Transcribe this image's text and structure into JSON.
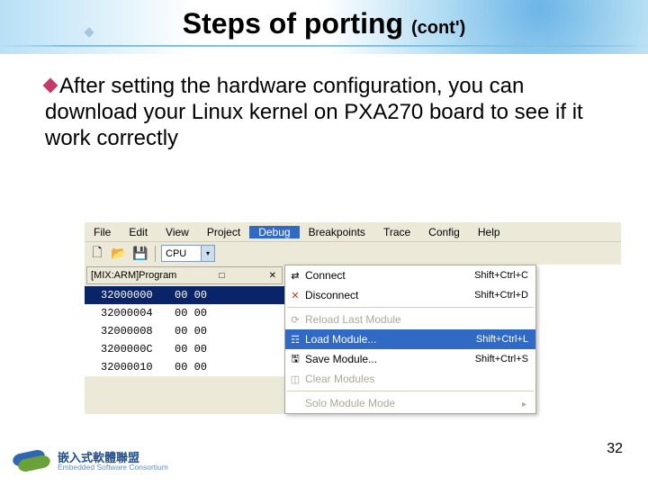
{
  "title": {
    "main": "Steps of porting ",
    "sub": "(cont')"
  },
  "body": "After setting the hardware configuration, you can download your Linux kernel on PXA270 board to see if it work correctly",
  "menubar": [
    "File",
    "Edit",
    "View",
    "Project",
    "Debug",
    "Breakpoints",
    "Trace",
    "Config",
    "Help"
  ],
  "menubar_selected": 4,
  "cpu_label": "CPU",
  "program_title": "[MIX:ARM]Program",
  "mem_rows": [
    {
      "addr": "32000000",
      "hex": "00  00"
    },
    {
      "addr": "32000004",
      "hex": "00  00"
    },
    {
      "addr": "32000008",
      "hex": "00  00"
    },
    {
      "addr": "3200000C",
      "hex": "00  00"
    },
    {
      "addr": "32000010",
      "hex": "00  00"
    }
  ],
  "menu": [
    {
      "icon": "⇄",
      "label": "Connect",
      "short": "Shift+Ctrl+C",
      "state": "en"
    },
    {
      "icon": "✕",
      "label": "Disconnect",
      "short": "Shift+Ctrl+D",
      "state": "en",
      "iconColor": "#c0392b"
    },
    {
      "sep": true
    },
    {
      "icon": "⟳",
      "label": "Reload Last Module",
      "short": "",
      "state": "dis"
    },
    {
      "icon": "☶",
      "label": "Load Module...",
      "short": "Shift+Ctrl+L",
      "state": "hl"
    },
    {
      "icon": "🖫",
      "label": "Save Module...",
      "short": "Shift+Ctrl+S",
      "state": "en"
    },
    {
      "icon": "◫",
      "label": "Clear Modules",
      "short": "",
      "state": "dis"
    },
    {
      "sep": true
    },
    {
      "icon": "",
      "label": "Solo Module Mode",
      "short": "",
      "state": "dis"
    }
  ],
  "footer": {
    "cn": "嵌入式軟體聯盟",
    "en": "Embedded Software Consortium"
  },
  "page": "32"
}
